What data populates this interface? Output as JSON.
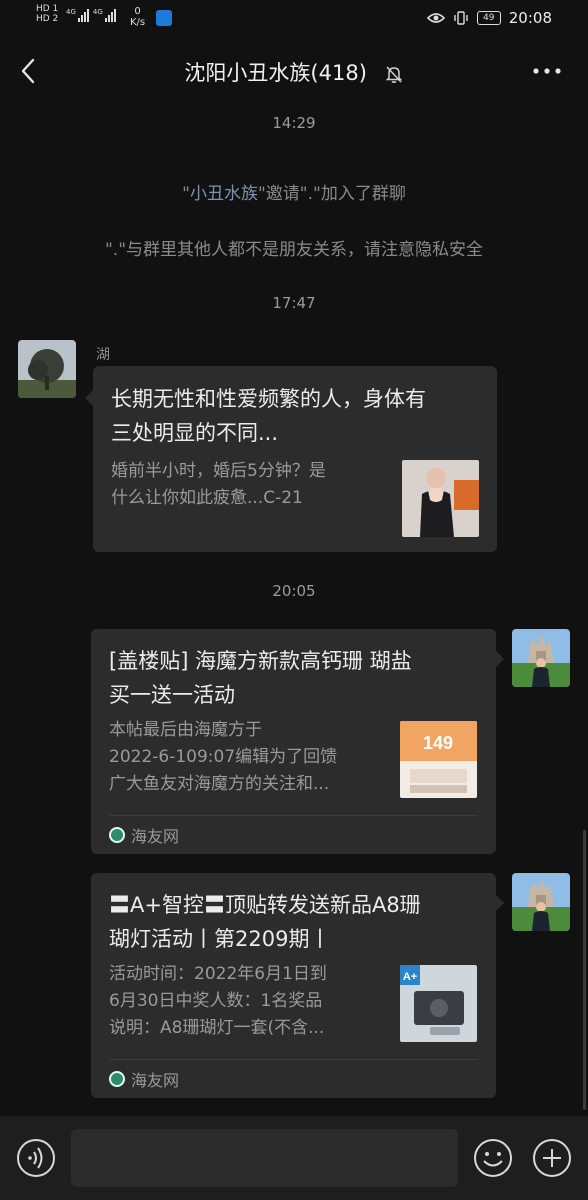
{
  "status_bar": {
    "sim1": "HD 1",
    "sim2": "HD 2",
    "net1": "4G",
    "net2": "4G",
    "speed_value": "0",
    "speed_unit": "K/s",
    "battery": "49",
    "clock": "20:08"
  },
  "header": {
    "title": "沈阳小丑水族(418)",
    "back_icon": "chevron-left-icon",
    "mute_icon": "bell-off-icon",
    "more_icon": "ellipsis-icon"
  },
  "chat": {
    "time1": "14:29",
    "system1": {
      "q1": "\"",
      "link": "小丑水族",
      "rest": "\"邀请\".\"加入了群聊"
    },
    "system2": "\".\"与群里其他人都不是朋友关系，请注意隐私安全",
    "time2": "17:47",
    "msg1": {
      "sender": "湖",
      "title_line1": "长期无性和性爱频繁的人，身体有",
      "title_line2": "三处明显的不同...",
      "desc_line1": "婚前半小时，婚后5分钟？是",
      "desc_line2": "什么让你如此疲惫...C-21"
    },
    "time3": "20:05",
    "msg2": {
      "title_line1": "[盖楼贴] 海魔方新款高钙珊 瑚盐",
      "title_line2": "买一送一活动",
      "desc_line1": "本帖最后由海魔方于",
      "desc_line2": "2022-6-109:07编辑为了回馈",
      "desc_line3": "广大鱼友对海魔方的关注和...",
      "source": "海友网",
      "thumb_text": "149"
    },
    "msg3": {
      "title_line1": "〓A+智控〓顶贴转发送新品A8珊",
      "title_line2": "瑚灯活动丨第2209期丨",
      "desc_line1": "活动时间：2022年6月1日到",
      "desc_line2": "6月30日中奖人数：1名奖品",
      "desc_line3": "说明：A8珊瑚灯一套(不含...",
      "source": "海友网",
      "thumb_text": "A+"
    }
  },
  "input_bar": {
    "voice_icon": "voice-icon",
    "emoji_icon": "emoji-icon",
    "plus_icon": "plus-icon"
  },
  "colors": {
    "background": "#111111",
    "bubble": "#2c2c2c",
    "link": "#7d93b3"
  }
}
